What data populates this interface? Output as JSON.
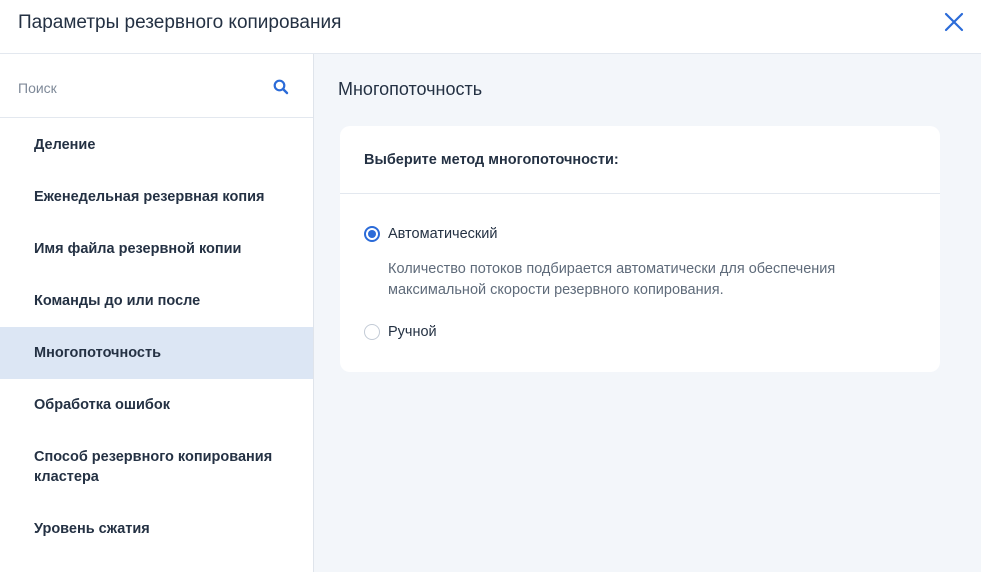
{
  "dialog": {
    "title": "Параметры резервного копирования",
    "close_icon": "close-icon"
  },
  "search": {
    "placeholder": "Поиск",
    "value": "",
    "icon": "search-icon"
  },
  "sidebar": {
    "items": [
      {
        "label": "Деление",
        "active": false
      },
      {
        "label": "Еженедельная резервная копия",
        "active": false
      },
      {
        "label": "Имя файла резервной копии",
        "active": false
      },
      {
        "label": "Команды до или после",
        "active": false
      },
      {
        "label": "Многопоточность",
        "active": true
      },
      {
        "label": "Обработка ошибок",
        "active": false
      },
      {
        "label": "Способ резервного копирования кластера",
        "active": false
      },
      {
        "label": "Уровень сжатия",
        "active": false
      }
    ]
  },
  "main": {
    "title": "Многопоточность",
    "card": {
      "header": "Выберите метод многопоточности:",
      "options": [
        {
          "label": "Автоматический",
          "selected": true,
          "description": "Количество потоков подбирается автоматически для обеспечения максимальной скорости резервного копирования."
        },
        {
          "label": "Ручной",
          "selected": false
        }
      ]
    }
  },
  "colors": {
    "accent": "#2b6bd8",
    "active_item_bg": "#dce6f4",
    "content_bg": "#f3f6fa",
    "text": "#243143",
    "muted_text": "#5f6b7a"
  }
}
